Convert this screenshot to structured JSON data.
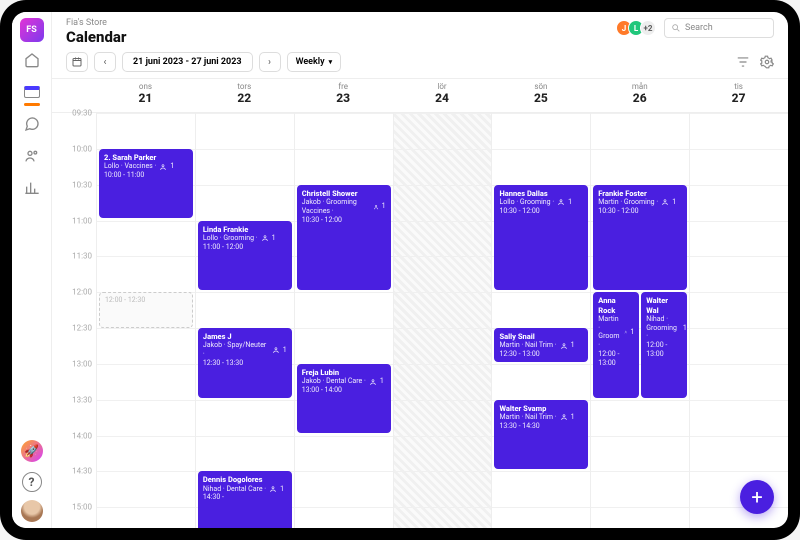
{
  "breadcrumb": "Fia's Store",
  "title": "Calendar",
  "logo": "FS",
  "date_range": "21 juni 2023 - 27 juni 2023",
  "view_mode": "Weekly",
  "search_placeholder": "Search",
  "avatar_chips": [
    {
      "letter": "J",
      "class": "j"
    },
    {
      "letter": "L",
      "class": "l"
    },
    {
      "letter": "+2",
      "class": "n"
    }
  ],
  "days": [
    {
      "dow": "ons",
      "num": "21"
    },
    {
      "dow": "tors",
      "num": "22"
    },
    {
      "dow": "fre",
      "num": "23"
    },
    {
      "dow": "lör",
      "num": "24"
    },
    {
      "dow": "sön",
      "num": "25"
    },
    {
      "dow": "mån",
      "num": "26"
    },
    {
      "dow": "tis",
      "num": "27"
    }
  ],
  "time_labels": [
    "09:30",
    "10:00",
    "10:30",
    "11:00",
    "11:30",
    "12:00",
    "12:30",
    "13:00",
    "13:30",
    "14:00",
    "14:30",
    "15:00"
  ],
  "ghost": {
    "label": "12:00 - 12:30",
    "day": 0,
    "start": "12:00",
    "end": "12:30"
  },
  "events": [
    {
      "day": 0,
      "start": "10:00",
      "end": "11:00",
      "title": "2. Sarah Parker",
      "sub": "Lollo · Vaccines",
      "people": "1",
      "time": "10:00 - 11:00"
    },
    {
      "day": 1,
      "start": "11:00",
      "end": "12:00",
      "title": "Linda Frankie",
      "sub": "Lollo · Grooming",
      "people": "1",
      "time": "11:00 - 12:00"
    },
    {
      "day": 1,
      "start": "12:30",
      "end": "13:30",
      "title": "James J",
      "sub": "Jakob · Spay/Neuter",
      "people": "1",
      "time": "12:30 - 13:30"
    },
    {
      "day": 1,
      "start": "14:30",
      "end": "15:30",
      "title": "Dennis Dogolores",
      "sub": "Nihad · Dental Care",
      "people": "1",
      "time": "14:30 - "
    },
    {
      "day": 2,
      "start": "10:30",
      "end": "12:00",
      "title": "Christell Shower",
      "sub": "Jakob · Grooming Vaccines",
      "people": "1",
      "time": "10:30 - 12:00"
    },
    {
      "day": 2,
      "start": "13:00",
      "end": "14:00",
      "title": "Freja Lubin",
      "sub": "Jakob · Dental Care",
      "people": "1",
      "time": "13:00 - 14:00"
    },
    {
      "day": 4,
      "start": "10:30",
      "end": "12:00",
      "title": "Hannes Dallas",
      "sub": "Lollo · Grooming",
      "people": "1",
      "time": "10:30 - 12:00"
    },
    {
      "day": 4,
      "start": "12:30",
      "end": "13:00",
      "title": "Sally Snail",
      "sub": "Martin · Nail Trim",
      "people": "1",
      "time": "12:30 - 13:00"
    },
    {
      "day": 4,
      "start": "13:30",
      "end": "14:30",
      "title": "Walter Svamp",
      "sub": "Martin · Nail Trim",
      "people": "1",
      "time": "13:30 - 14:30"
    },
    {
      "day": 5,
      "start": "10:30",
      "end": "12:00",
      "title": "Frankie Foster",
      "sub": "Martin · Grooming",
      "people": "1",
      "time": "10:30 - 12:00"
    },
    {
      "day": 5,
      "start": "12:00",
      "end": "13:30",
      "title": "Anna Rock",
      "sub": "Martin · Groom",
      "people": "1",
      "time": "12:00 - 13:00",
      "split": "left"
    },
    {
      "day": 5,
      "start": "12:00",
      "end": "13:30",
      "title": "Walter Wal",
      "sub": "Nihad · Grooming",
      "people": "1",
      "time": "12:00 - 13:00",
      "split": "right"
    }
  ],
  "fab_label": "+"
}
